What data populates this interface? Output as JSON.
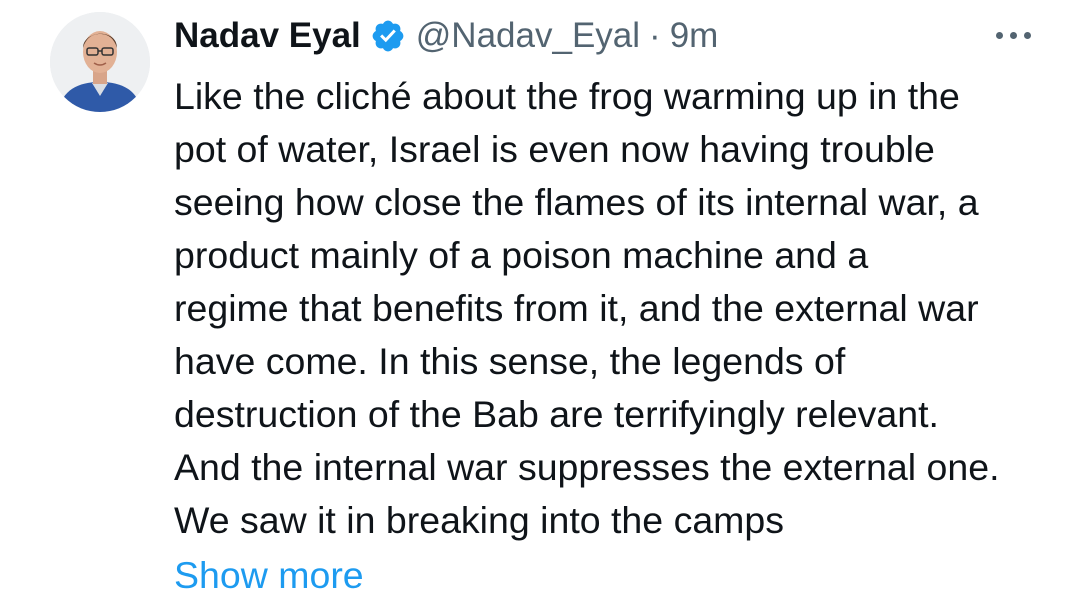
{
  "tweet": {
    "author_name": "Nadav Eyal",
    "handle": "@Nadav_Eyal",
    "separator": "·",
    "time": "9m",
    "verified": true,
    "lines": [
      "Like the cliché about the frog warming up in the",
      "pot of water, Israel is even now having trouble",
      "seeing how close the flames of its internal war, a",
      "product mainly of a poison machine and a",
      "regime that benefits from it, and the external war",
      "have come. In this sense, the legends of",
      "destruction of the Bab are terrifyingly relevant.",
      "And the internal war suppresses the external one.",
      "We saw it in breaking into the camps"
    ],
    "show_more_label": "Show more"
  },
  "icons": {
    "verified": "verified-badge-icon",
    "more": "more-options-icon"
  },
  "colors": {
    "text": "#0f1419",
    "secondary": "#536471",
    "link": "#1d9bf0",
    "verified": "#1d9bf0"
  }
}
